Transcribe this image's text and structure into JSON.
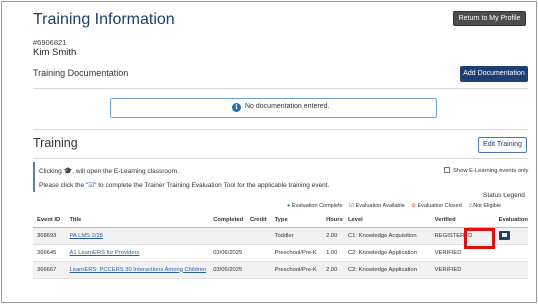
{
  "header": {
    "title": "Training Information",
    "return_button": "Return to My Profile"
  },
  "user": {
    "id": "#6906821",
    "name": "Kim Smith"
  },
  "documentation": {
    "title": "Training Documentation",
    "add_button": "Add Documentation",
    "empty_message": "No documentation entered.",
    "info_icon": "info-icon"
  },
  "training": {
    "title": "Training",
    "edit_button": "Edit Training",
    "info_line1_prefix": "Clicking",
    "info_line1_icon": "graduation-cap-icon",
    "info_line1_suffix": ", will open the E-Learning classroom.",
    "info_line2_prefix": "Please click the \"",
    "info_line2_link": "☑",
    "info_line2_suffix": "\" to complete the Trainer Training Evaluation Tool for the applicable training event.",
    "show_elearning_label": "Show E-Learning events only"
  },
  "status_legend": {
    "title": "Status Legend",
    "items": [
      {
        "icon": "green-dot-icon",
        "glyph": "●",
        "label": "Evaluation Complete",
        "color": "#3a9a3a"
      },
      {
        "icon": "edit-square-icon",
        "glyph": "☑",
        "label": "Evaluation Available",
        "color": "#2a6db5"
      },
      {
        "icon": "no-entry-icon",
        "glyph": "⊘",
        "label": "Evaluation Closed",
        "color": "#c0392b"
      },
      {
        "icon": "warning-icon",
        "glyph": "⚠",
        "label": "Not Eligible",
        "color": "#777777"
      }
    ]
  },
  "table": {
    "columns": [
      "Event ID",
      "Title",
      "Completed",
      "Credit",
      "Type",
      "Hours",
      "Level",
      "Verified",
      "Evaluation"
    ],
    "rows": [
      {
        "event_id": "368693",
        "title": "PA LMS 2/28",
        "completed": "",
        "credit": "",
        "type": "Toddler",
        "hours": "2.00",
        "level": "C1: Knowledge Acquisition",
        "verified": "REGISTERED",
        "evaluation": "evaluate-button"
      },
      {
        "event_id": "366645",
        "title": "A1 LearnERS for Providers",
        "completed": "03/06/2025",
        "credit": "",
        "type": "Preschool/Pre-K",
        "hours": "1.00",
        "level": "C2: Knowledge Application",
        "verified": "VERIFIED",
        "evaluation": ""
      },
      {
        "event_id": "366667",
        "title": "LearnERS: PCCERS 30 Interactions Among Children",
        "completed": "03/06/2025",
        "credit": "",
        "type": "Preschool/Pre-K",
        "hours": "2.00",
        "level": "C2: Knowledge Application",
        "verified": "VERIFIED",
        "evaluation": ""
      }
    ]
  },
  "colors": {
    "title": "#1f3d6b",
    "primary_button": "#1e3f73",
    "dark_button": "#4d4d4d",
    "highlight": "#e01010",
    "link": "#2a5ea8"
  }
}
